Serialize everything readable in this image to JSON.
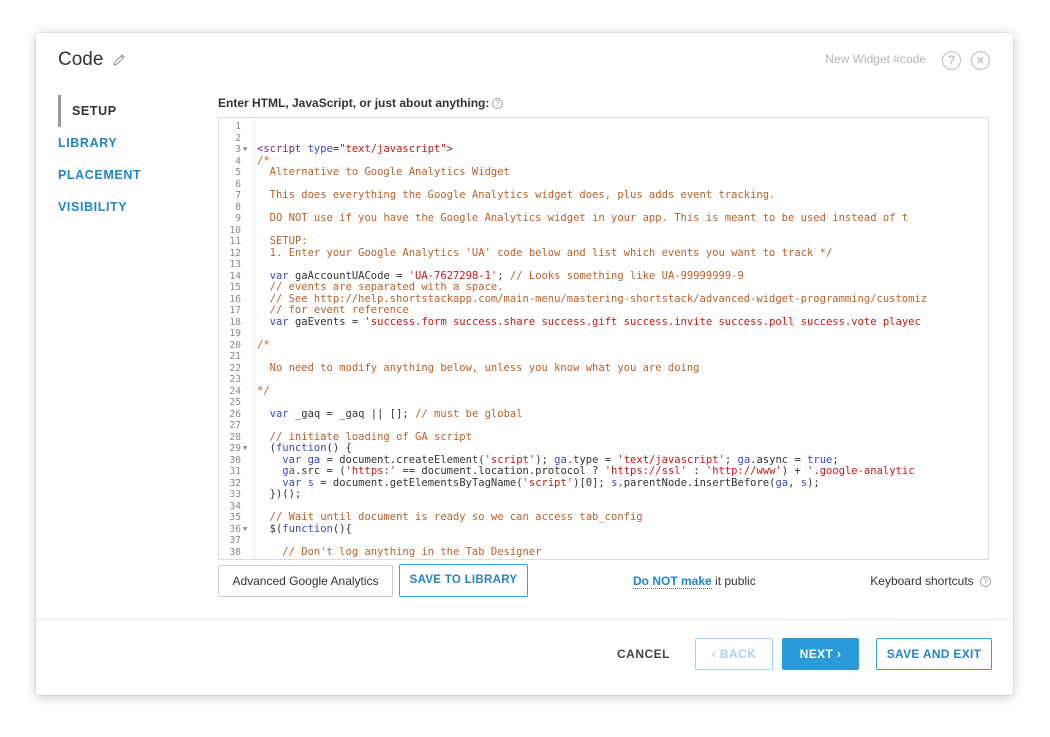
{
  "modal": {
    "title": "Code",
    "widget_name": "New Widget #code",
    "help_glyph": "?",
    "close_glyph": "×"
  },
  "sidebar": {
    "items": [
      {
        "label": "SETUP",
        "active": true
      },
      {
        "label": "LIBRARY",
        "active": false
      },
      {
        "label": "PLACEMENT",
        "active": false
      },
      {
        "label": "VISIBILITY",
        "active": false
      }
    ]
  },
  "editor": {
    "label": "Enter HTML, JavaScript, or just about anything:",
    "info_glyph": "?",
    "lines": [
      {
        "n": "1",
        "fold": false,
        "segs": []
      },
      {
        "n": "2",
        "fold": false,
        "segs": []
      },
      {
        "n": "3",
        "fold": true,
        "segs": [
          {
            "t": "<script ",
            "c": "tag"
          },
          {
            "t": "type",
            "c": "attr"
          },
          {
            "t": "=",
            "c": ""
          },
          {
            "t": "\"text/javascript\"",
            "c": "str"
          },
          {
            "t": ">",
            "c": "tag"
          }
        ]
      },
      {
        "n": "4",
        "fold": false,
        "segs": [
          {
            "t": "/*",
            "c": "com"
          }
        ]
      },
      {
        "n": "5",
        "fold": false,
        "segs": [
          {
            "t": "  Alternative to Google Analytics Widget",
            "c": "com"
          }
        ]
      },
      {
        "n": "6",
        "fold": false,
        "segs": []
      },
      {
        "n": "7",
        "fold": false,
        "segs": [
          {
            "t": "  This does everything the Google Analytics widget does, plus adds event tracking.",
            "c": "com"
          }
        ]
      },
      {
        "n": "8",
        "fold": false,
        "segs": []
      },
      {
        "n": "9",
        "fold": false,
        "segs": [
          {
            "t": "  DO NOT use if you have the Google Analytics widget in your app. This is meant to be used instead of t",
            "c": "com"
          }
        ]
      },
      {
        "n": "10",
        "fold": false,
        "segs": []
      },
      {
        "n": "11",
        "fold": false,
        "segs": [
          {
            "t": "  SETUP:",
            "c": "com"
          }
        ]
      },
      {
        "n": "12",
        "fold": false,
        "segs": [
          {
            "t": "  1. Enter your Google Analytics 'UA' code below and list which events you want to track */",
            "c": "com"
          }
        ]
      },
      {
        "n": "13",
        "fold": false,
        "segs": []
      },
      {
        "n": "14",
        "fold": false,
        "segs": [
          {
            "t": "  ",
            "c": ""
          },
          {
            "t": "var",
            "c": "kw"
          },
          {
            "t": " gaAccountUACode = ",
            "c": ""
          },
          {
            "t": "'UA-7627298-1'",
            "c": "str"
          },
          {
            "t": "; ",
            "c": ""
          },
          {
            "t": "// Looks something like UA-99999999-9",
            "c": "com"
          }
        ]
      },
      {
        "n": "15",
        "fold": false,
        "segs": [
          {
            "t": "  // events are separated with a space.",
            "c": "com"
          }
        ]
      },
      {
        "n": "16",
        "fold": false,
        "segs": [
          {
            "t": "  // See http://help.shortstackapp.com/main-menu/mastering-shortstack/advanced-widget-programming/customiz",
            "c": "com"
          }
        ]
      },
      {
        "n": "17",
        "fold": false,
        "segs": [
          {
            "t": "  // for event reference",
            "c": "com"
          }
        ]
      },
      {
        "n": "18",
        "fold": false,
        "segs": [
          {
            "t": "  ",
            "c": ""
          },
          {
            "t": "var",
            "c": "kw"
          },
          {
            "t": " gaEvents = ",
            "c": ""
          },
          {
            "t": "'success.form success.share success.gift success.invite success.poll success.vote playec",
            "c": "str"
          }
        ]
      },
      {
        "n": "19",
        "fold": false,
        "segs": []
      },
      {
        "n": "20",
        "fold": false,
        "segs": [
          {
            "t": "/*",
            "c": "com"
          }
        ]
      },
      {
        "n": "21",
        "fold": false,
        "segs": []
      },
      {
        "n": "22",
        "fold": false,
        "segs": [
          {
            "t": "  No need to modify anything below, unless you know what you are doing",
            "c": "com"
          }
        ]
      },
      {
        "n": "23",
        "fold": false,
        "segs": []
      },
      {
        "n": "24",
        "fold": false,
        "segs": [
          {
            "t": "*/",
            "c": "com"
          }
        ]
      },
      {
        "n": "25",
        "fold": false,
        "segs": []
      },
      {
        "n": "26",
        "fold": false,
        "segs": [
          {
            "t": "  ",
            "c": ""
          },
          {
            "t": "var",
            "c": "kw"
          },
          {
            "t": " _gaq = _gaq || []; ",
            "c": ""
          },
          {
            "t": "// must be global",
            "c": "com"
          }
        ]
      },
      {
        "n": "27",
        "fold": false,
        "segs": []
      },
      {
        "n": "28",
        "fold": false,
        "segs": [
          {
            "t": "  // initiate loading of GA script",
            "c": "com"
          }
        ]
      },
      {
        "n": "29",
        "fold": true,
        "segs": [
          {
            "t": "  (",
            "c": ""
          },
          {
            "t": "function",
            "c": "kw"
          },
          {
            "t": "() {",
            "c": ""
          }
        ]
      },
      {
        "n": "30",
        "fold": false,
        "segs": [
          {
            "t": "    ",
            "c": ""
          },
          {
            "t": "var",
            "c": "kw"
          },
          {
            "t": " ",
            "c": ""
          },
          {
            "t": "ga",
            "c": "kw"
          },
          {
            "t": " = document.createElement(",
            "c": ""
          },
          {
            "t": "'script'",
            "c": "str"
          },
          {
            "t": "); ",
            "c": ""
          },
          {
            "t": "ga",
            "c": "kw"
          },
          {
            "t": ".type = ",
            "c": ""
          },
          {
            "t": "'text/javascript'",
            "c": "str"
          },
          {
            "t": "; ",
            "c": ""
          },
          {
            "t": "ga",
            "c": "kw"
          },
          {
            "t": ".async = ",
            "c": ""
          },
          {
            "t": "true",
            "c": "kw"
          },
          {
            "t": ";",
            "c": ""
          }
        ]
      },
      {
        "n": "31",
        "fold": false,
        "segs": [
          {
            "t": "    ",
            "c": ""
          },
          {
            "t": "ga",
            "c": "kw"
          },
          {
            "t": ".src = (",
            "c": ""
          },
          {
            "t": "'https:'",
            "c": "str"
          },
          {
            "t": " == document.location.protocol ? ",
            "c": ""
          },
          {
            "t": "'https://ssl'",
            "c": "str"
          },
          {
            "t": " : ",
            "c": ""
          },
          {
            "t": "'http://www'",
            "c": "str"
          },
          {
            "t": ") + ",
            "c": ""
          },
          {
            "t": "'.google-analytic",
            "c": "str"
          }
        ]
      },
      {
        "n": "32",
        "fold": false,
        "segs": [
          {
            "t": "    ",
            "c": ""
          },
          {
            "t": "var",
            "c": "kw"
          },
          {
            "t": " ",
            "c": ""
          },
          {
            "t": "s",
            "c": "kw"
          },
          {
            "t": " = document.getElementsByTagName(",
            "c": ""
          },
          {
            "t": "'script'",
            "c": "str"
          },
          {
            "t": ")[0]; ",
            "c": ""
          },
          {
            "t": "s",
            "c": "kw"
          },
          {
            "t": ".parentNode.insertBefore(",
            "c": ""
          },
          {
            "t": "ga",
            "c": "kw"
          },
          {
            "t": ", ",
            "c": ""
          },
          {
            "t": "s",
            "c": "kw"
          },
          {
            "t": ");",
            "c": ""
          }
        ]
      },
      {
        "n": "33",
        "fold": false,
        "segs": [
          {
            "t": "  })();",
            "c": ""
          }
        ]
      },
      {
        "n": "34",
        "fold": false,
        "segs": []
      },
      {
        "n": "35",
        "fold": false,
        "segs": [
          {
            "t": "  // Wait until document is ready so we can access tab_config",
            "c": "com"
          }
        ]
      },
      {
        "n": "36",
        "fold": true,
        "segs": [
          {
            "t": "  $(",
            "c": ""
          },
          {
            "t": "function",
            "c": "kw"
          },
          {
            "t": "(){",
            "c": ""
          }
        ]
      },
      {
        "n": "37",
        "fold": false,
        "segs": []
      },
      {
        "n": "38",
        "fold": false,
        "segs": [
          {
            "t": "    // Don't log anything in the Tab Designer",
            "c": "com"
          }
        ]
      }
    ]
  },
  "actions": {
    "advanced_ga_label": "Advanced Google Analytics",
    "save_library_label": "SAVE TO LIBRARY",
    "public_link": "Do NOT make",
    "public_suffix": " it public",
    "keyboard_shortcuts": "Keyboard shortcuts",
    "kb_info_glyph": "?"
  },
  "footer": {
    "cancel": "CANCEL",
    "back": "‹ BACK",
    "next": "NEXT ›",
    "save_exit": "SAVE AND EXIT"
  },
  "colors": {
    "accent": "#2a9ad8",
    "link": "#2683c4",
    "comment": "#b8622a",
    "string": "#c41a16",
    "keyword": "#3b48c4"
  }
}
